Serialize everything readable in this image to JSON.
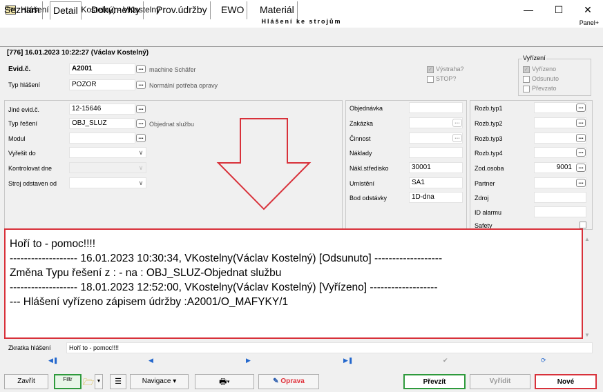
{
  "window": {
    "title": "Hlášení (Václav Kostelný) - VKostelny",
    "banner": "Hlášení ke strojům",
    "panel_toggle": "Panel+",
    "icon_text": "TPV"
  },
  "tabs": [
    {
      "label": "Seznam"
    },
    {
      "label": "Detail"
    },
    {
      "label": "Dokumenty"
    },
    {
      "label": "Prov.údržby"
    },
    {
      "label": "EWO"
    },
    {
      "label": "Materiál"
    }
  ],
  "record_header": "[776] 16.01.2023 10:22:27 (Václav Kostelný)",
  "top": {
    "evid_label": "Evid.č.",
    "evid_value": "A2001",
    "evid_note": "machine Schäfer",
    "typ_hlaseni_label": "Typ hlášení",
    "typ_hlaseni_value": "POZOR",
    "typ_hlaseni_note": "Normální potřeba opravy",
    "vystraha_label": "Výstraha?",
    "stop_label": "STOP?"
  },
  "vyrizeni": {
    "title": "Vyřízení",
    "options": [
      "Vyřízeno",
      "Odsunuto",
      "Převzato"
    ]
  },
  "left_panel": {
    "jine_evid_label": "Jiné evid.č.",
    "jine_evid_value": "12-15646",
    "typ_reseni_label": "Typ řešení",
    "typ_reseni_value": "OBJ_SLUZ",
    "typ_reseni_note": "Objednat službu",
    "modul_label": "Modul",
    "vyresit_do_label": "Vyřešit do",
    "kontrolovat_dne_label": "Kontrolovat dne",
    "stroj_odstaven_label": "Stroj odstaven od"
  },
  "mid_panel": {
    "objednavka_label": "Objednávka",
    "zakazka_label": "Zakázka",
    "cinnost_label": "Činnost",
    "naklady_label": "Náklady",
    "nakl_stredisko_label": "Nákl.středisko",
    "nakl_stredisko_value": "30001",
    "umisteni_label": "Umístění",
    "umisteni_value": "SA1",
    "bod_odstavky_label": "Bod odstávky",
    "bod_odstavky_value": "1D-dna"
  },
  "right_panel": {
    "rozb1_label": "Rozb.typ1",
    "rozb2_label": "Rozb.typ2",
    "rozb3_label": "Rozb.typ3",
    "rozb4_label": "Rozb.typ4",
    "zod_osoba_label": "Zod.osoba",
    "zod_osoba_value": "9001",
    "partner_label": "Partner",
    "zdroj_label": "Zdroj",
    "id_alarmu_label": "ID alarmu",
    "safety_label": "Safety"
  },
  "memo_lines": [
    "Hoří to - pomoc!!!!",
    "------------------- 16.01.2023 10:30:34, VKostelny(Václav Kostelný)  [Odsunuto] -------------------",
    "Změna Typu řešení z : - na : OBJ_SLUZ-Objednat službu",
    "------------------- 18.01.2023 12:52:00, VKostelny(Václav Kostelný)  [Vyřízeno] -------------------",
    "--- Hlášení vyřízeno zápisem údržby :A2001/O_MAFYKY/1"
  ],
  "zkratka": {
    "label": "Zkratka hlášení",
    "value": "Hoří to - pomoc!!!!"
  },
  "toolbar": {
    "zavrit": "Zavřít",
    "filtr": "Filtr",
    "navigace": "Navigace",
    "oprava": "Oprava",
    "prevzit": "Převzít",
    "vyridit": "Vyřídit",
    "nove": "Nové"
  },
  "colors": {
    "highlight_red": "#d8313a",
    "oprava_red": "#e0303a",
    "prevzit_green": "#2e9a3c",
    "nav_blue": "#2266cc"
  }
}
